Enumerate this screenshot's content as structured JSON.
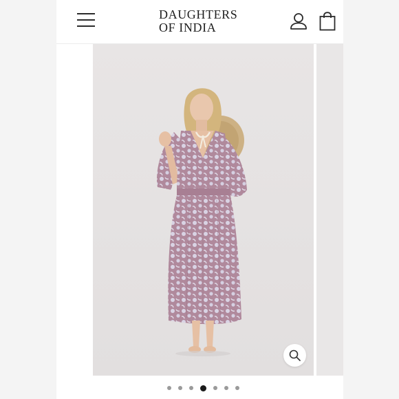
{
  "header": {
    "brand_line1": "DAUGHTERS",
    "brand_line2": "OF INDIA",
    "menu_icon": "hamburger-menu-icon",
    "account_icon": "user-account-icon",
    "cart_icon": "shopping-bag-icon"
  },
  "gallery": {
    "zoom_icon": "zoom-magnifier-icon",
    "slide_count": 7,
    "active_slide": 4
  },
  "colors": {
    "dress_base": "#b0899c",
    "dress_print": "#d9d3e4",
    "backdrop": "#e6e3e3",
    "active_dot": "#1a1a1a",
    "inactive_dot": "#9a9a9a"
  }
}
